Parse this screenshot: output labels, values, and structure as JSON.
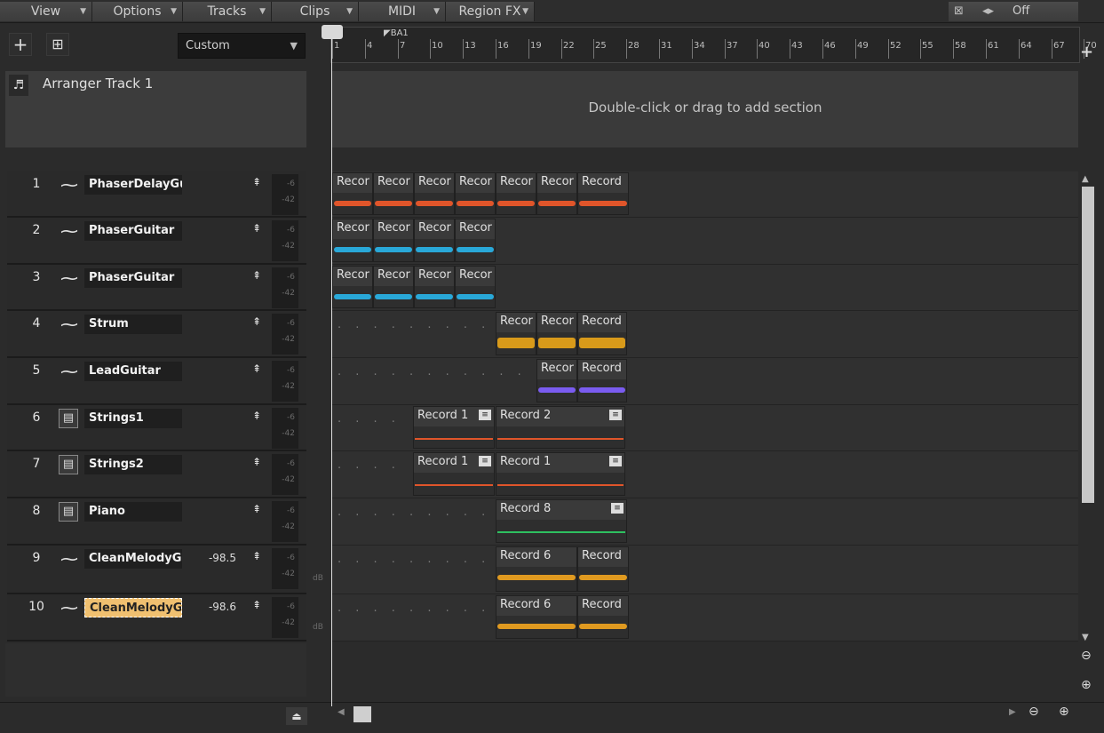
{
  "menubar": {
    "items": [
      {
        "label": "View"
      },
      {
        "label": "Options"
      },
      {
        "label": "Tracks"
      },
      {
        "label": "Clips"
      },
      {
        "label": "MIDI"
      },
      {
        "label": "Region FX"
      }
    ],
    "automation_label": "Off"
  },
  "header": {
    "preset": "Custom"
  },
  "arranger": {
    "track_name": "Arranger Track 1",
    "hint": "Double-click or drag to add section"
  },
  "ruler": {
    "ticks": [
      "1",
      "4",
      "7",
      "10",
      "13",
      "16",
      "19",
      "22",
      "25",
      "28",
      "31",
      "34",
      "37",
      "40",
      "43",
      "46",
      "49",
      "52",
      "55",
      "58",
      "61",
      "64",
      "67",
      "70",
      "7"
    ],
    "marker": "BA1"
  },
  "meter": {
    "high": "-6",
    "low": "-42",
    "db": "dB"
  },
  "tracks": [
    {
      "num": "1",
      "name": "PhaserDelayGuit",
      "type": "audio",
      "vol": ""
    },
    {
      "num": "2",
      "name": "PhaserGuitar",
      "type": "audio",
      "vol": ""
    },
    {
      "num": "3",
      "name": "PhaserGuitar",
      "type": "audio",
      "vol": ""
    },
    {
      "num": "4",
      "name": "Strum",
      "type": "audio",
      "vol": ""
    },
    {
      "num": "5",
      "name": "LeadGuitar",
      "type": "audio",
      "vol": ""
    },
    {
      "num": "6",
      "name": "Strings1",
      "type": "instrument",
      "vol": ""
    },
    {
      "num": "7",
      "name": "Strings2",
      "type": "instrument",
      "vol": ""
    },
    {
      "num": "8",
      "name": "Piano",
      "type": "instrument",
      "vol": ""
    },
    {
      "num": "9",
      "name": "CleanMelodyGui",
      "type": "audio",
      "vol": "-98.5"
    },
    {
      "num": "10",
      "name": "CleanMelodyGui",
      "type": "audio",
      "vol": "-98.6"
    }
  ],
  "clips": {
    "t1": [
      "Recor",
      "Recor",
      "Recor",
      "Recor",
      "Recor",
      "Recor",
      "Record"
    ],
    "t2": [
      "Recor",
      "Recor",
      "Recor",
      "Recor"
    ],
    "t3": [
      "Recor",
      "Recor",
      "Recor",
      "Recor"
    ],
    "t4": [
      "Recor",
      "Recor",
      "Record"
    ],
    "t5": [
      "Recor",
      "Record"
    ],
    "t6": [
      "Record 1",
      "Record 2"
    ],
    "t7": [
      "Record 1",
      "Record 1"
    ],
    "t8": [
      "Record 8"
    ],
    "t9": [
      "Record 6",
      "Record"
    ],
    "t10": [
      "Record 6",
      "Record"
    ]
  },
  "colors": {
    "orange": "#e0552a",
    "cyan": "#29a8d8",
    "amber": "#d89a1a",
    "purple": "#7a5cf0",
    "green": "#2ec060",
    "gold": "#e09a20"
  }
}
